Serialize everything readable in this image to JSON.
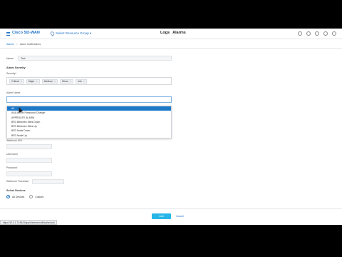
{
  "topnav": {
    "brand": "Cisco SD-WAN",
    "resource_group": "Select Resource Group ▾",
    "title_logs": "Logs",
    "title_alarms": "Alarms"
  },
  "breadcrumb": {
    "home": "Alarms",
    "separator": ">",
    "current": "Alarm Notifications"
  },
  "form": {
    "name_label": "Name*",
    "name_value": "Test",
    "section_severity": "Alarm Severity",
    "severity_label": "Severity*",
    "severity_chips": [
      "Critical",
      "Major",
      "Medium",
      "Minor",
      "Info"
    ],
    "alarm_name_label": "Alarm Name",
    "dropdown_items": [
      "All",
      "AAA Admin Password Change",
      "APPROUTE ALARM",
      "BFD Between Sites Down",
      "BFD Between Sites Up",
      "BFD Node Down",
      "BFD Node Up"
    ],
    "webhook_url_label": "Webhook URL",
    "username_label": "Username",
    "password_label": "Password",
    "threshold_label": "Webhook Threshold",
    "section_devices": "Select Devices",
    "radio_all": "All Devices",
    "radio_custom": "Custom"
  },
  "buttons": {
    "add": "Add",
    "cancel": "Cancel"
  },
  "status_url": "https://10.0.1.74:8443/app/#/alarms/notification/add"
}
